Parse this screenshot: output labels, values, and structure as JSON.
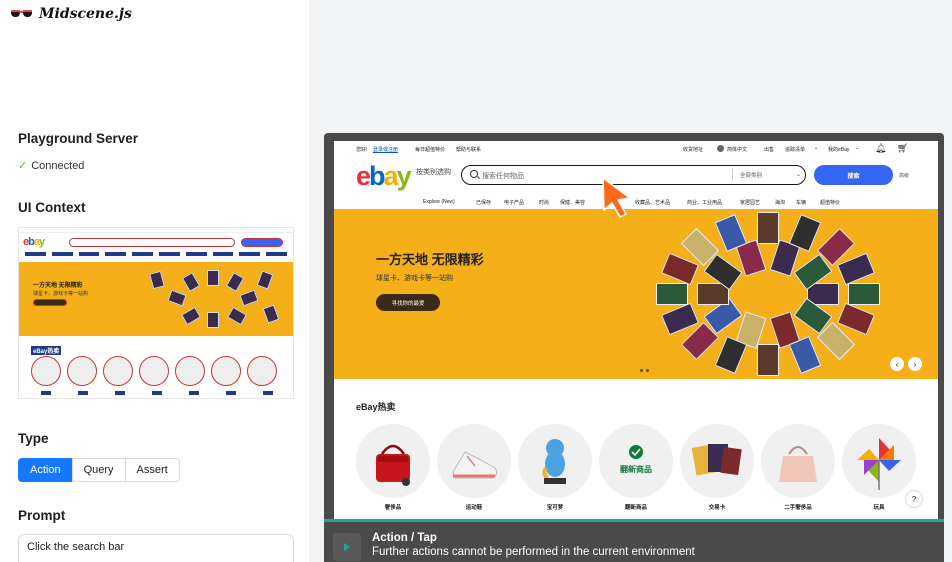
{
  "brand": {
    "name": "Midscene.js"
  },
  "sections": {
    "server_title": "Playground Server",
    "server_status": "Connected",
    "context_title": "UI Context",
    "type_title": "Type",
    "prompt_title": "Prompt"
  },
  "thumbnail": {
    "banner_title": "一方天地 无限精彩",
    "banner_sub": "球星卡、游戏卡等一站购",
    "hot_label": "eBay热卖"
  },
  "type_tabs": [
    {
      "label": "Action",
      "active": true
    },
    {
      "label": "Query",
      "active": false
    },
    {
      "label": "Assert",
      "active": false
    }
  ],
  "prompt": {
    "value": "Click the search bar"
  },
  "ebay": {
    "top_links": {
      "greeting": "您好!",
      "login": "登录或注册",
      "deals": "每日超值特价",
      "help": "帮助与联系",
      "ship_to": "收货地址",
      "language": "简体中文",
      "sell": "出售",
      "watchlist": "追踪清单",
      "my_ebay": "我的eBay"
    },
    "shop_by_category": "按类别选购",
    "search_placeholder": "搜索任何物品",
    "all_categories": "全部类别",
    "search_button": "搜索",
    "advanced": "高级",
    "nav": [
      "Explore (New)",
      "已保存",
      "电子产品",
      "时尚",
      "保健、美容",
      "收藏品、艺术品",
      "商业、工业用品",
      "家居园艺",
      "海淘",
      "车辆",
      "超值特价"
    ],
    "banner": {
      "title": "一方天地 无限精彩",
      "subtitle": "球星卡、游戏卡等一站购",
      "cta": "寻找你的最爱"
    },
    "hot_title": "eBay热卖",
    "hot_items": [
      {
        "label": "奢侈品",
        "icon": "handbag-icon"
      },
      {
        "label": "运动鞋",
        "icon": "sneaker-icon"
      },
      {
        "label": "宝可梦",
        "icon": "pokemon-icon"
      },
      {
        "label": "翻新商品",
        "icon": "refurbished-icon",
        "badge_text": "翻新商品"
      },
      {
        "label": "交易卡",
        "icon": "trading-card-icon"
      },
      {
        "label": "二手奢侈品",
        "icon": "tote-bag-icon"
      },
      {
        "label": "玩具",
        "icon": "pinwheel-icon"
      }
    ],
    "help_icon_text": "?"
  },
  "status_bar": {
    "title": "Action / Tap",
    "message": "Further actions cannot be performed in the current environment"
  },
  "colors": {
    "accent": "#1677ff",
    "ebay_blue": "#3665f3",
    "banner_yellow": "#f5af19",
    "status_teal": "#1aa898",
    "connected_green": "#52c41a"
  }
}
